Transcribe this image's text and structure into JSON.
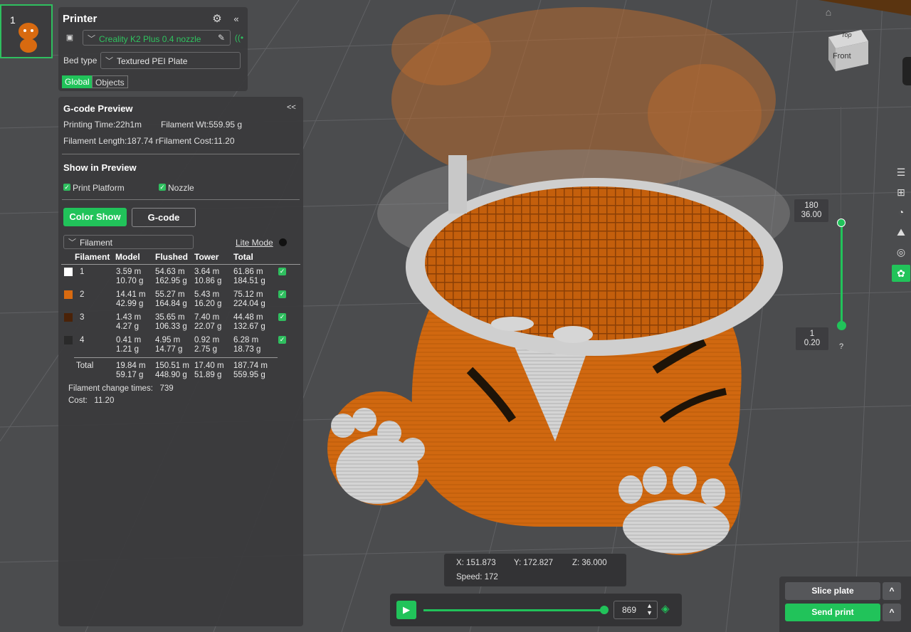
{
  "plate": {
    "number": "1"
  },
  "printer": {
    "title": "Printer",
    "model": "Creality K2 Plus 0.4 nozzle",
    "bed_type_label": "Bed type",
    "bed_type_value": "Textured PEI Plate",
    "tabs": [
      "Global",
      "Objects"
    ]
  },
  "gcode_preview": {
    "title": "G-code Preview",
    "collapse": "<<",
    "printing_time": "Printing Time:22h1m",
    "filament_weight": "Filament Wt:559.95 g",
    "filament_length": "Filament Length:187.74 m",
    "filament_cost": "Filament Cost:11.20"
  },
  "show_in_preview": {
    "title": "Show in Preview",
    "print_platform": "Print Platform",
    "nozzle": "Nozzle"
  },
  "view_modes": {
    "color_show": "Color Show",
    "gcode": "G-code"
  },
  "filament_table": {
    "dropdown": "Filament",
    "lite_mode": "Lite Mode",
    "headers": [
      "Filament",
      "Model",
      "Flushed",
      "Tower",
      "Total"
    ],
    "rows": [
      {
        "id": "1",
        "color": "#ffffff",
        "model": "3.59 m\n10.70 g",
        "flushed": "54.63 m\n162.95 g",
        "tower": "3.64 m\n10.86 g",
        "total": "61.86 m\n184.51 g"
      },
      {
        "id": "2",
        "color": "#d86a10",
        "model": "14.41 m\n42.99 g",
        "flushed": "55.27 m\n164.84 g",
        "tower": "5.43 m\n16.20 g",
        "total": "75.12 m\n224.04 g"
      },
      {
        "id": "3",
        "color": "#4a2208",
        "model": "1.43 m\n4.27 g",
        "flushed": "35.65 m\n106.33 g",
        "tower": "7.40 m\n22.07 g",
        "total": "44.48 m\n132.67 g"
      },
      {
        "id": "4",
        "color": "#2a2a2a",
        "model": "0.41 m\n1.21 g",
        "flushed": "4.95 m\n14.77 g",
        "tower": "0.92 m\n2.75 g",
        "total": "6.28 m\n18.73 g"
      }
    ],
    "total_row": {
      "label": "Total",
      "model": "19.84 m\n59.17 g",
      "flushed": "150.51 m\n448.90 g",
      "tower": "17.40 m\n51.89 g",
      "total": "187.74 m\n559.95 g"
    },
    "change_times": "Filament change times:   739",
    "cost": "Cost:   11.20"
  },
  "coords": {
    "x": "X: 151.873",
    "y": "Y: 172.827",
    "z": "Z: 36.000",
    "speed": "Speed: 172"
  },
  "layer_slider": {
    "top_layer": "180",
    "top_height": "36.00",
    "bottom_layer": "1",
    "bottom_height": "0.20",
    "help": "?"
  },
  "nav_cube": {
    "top": "Top",
    "front": "Front"
  },
  "playback": {
    "move_index": "869",
    "progress": 1.0
  },
  "actions": {
    "slice": "Slice plate",
    "send": "Send print",
    "expand": "^"
  },
  "colors": {
    "accent": "#21c35a",
    "panel": "#3a3a3c",
    "orange": "#d86a10",
    "gray_print": "#cfcfcf"
  }
}
